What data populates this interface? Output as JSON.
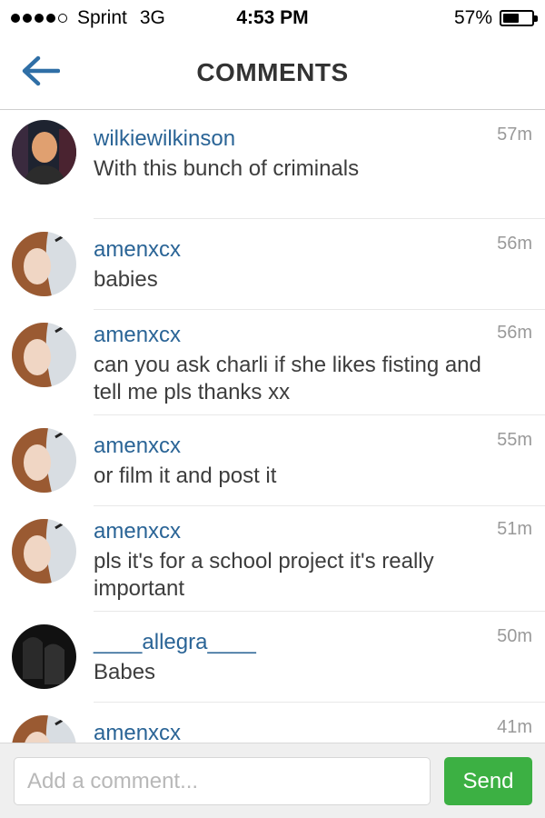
{
  "status_bar": {
    "carrier": "Sprint",
    "network": "3G",
    "time": "4:53 PM",
    "battery_percent_label": "57%",
    "battery_level": 0.57,
    "signal_bars_filled": 4,
    "signal_bars_total": 5
  },
  "header": {
    "title": "COMMENTS",
    "back_icon": "back-arrow-icon"
  },
  "comments": [
    {
      "username": "wilkiewilkinson",
      "text": "With this bunch of criminals",
      "time": "57m"
    },
    {
      "username": "amenxcx",
      "text": "babies",
      "time": "56m"
    },
    {
      "username": "amenxcx",
      "text": "can you ask charli if she likes fisting and tell me pls thanks xx",
      "time": "56m"
    },
    {
      "username": "amenxcx",
      "text": "or film it and post it",
      "time": "55m"
    },
    {
      "username": "amenxcx",
      "text": "pls it's for a school project it's really important",
      "time": "51m"
    },
    {
      "username": "____allegra____",
      "text": "Babes",
      "time": "50m"
    },
    {
      "username": "amenxcx",
      "text": "",
      "time": "41m"
    }
  ],
  "composer": {
    "placeholder": "Add a comment...",
    "value": "",
    "send_label": "Send"
  },
  "colors": {
    "username": "#2a6496",
    "send_button": "#3cb043",
    "accent_back_arrow": "#2f6fa6"
  }
}
